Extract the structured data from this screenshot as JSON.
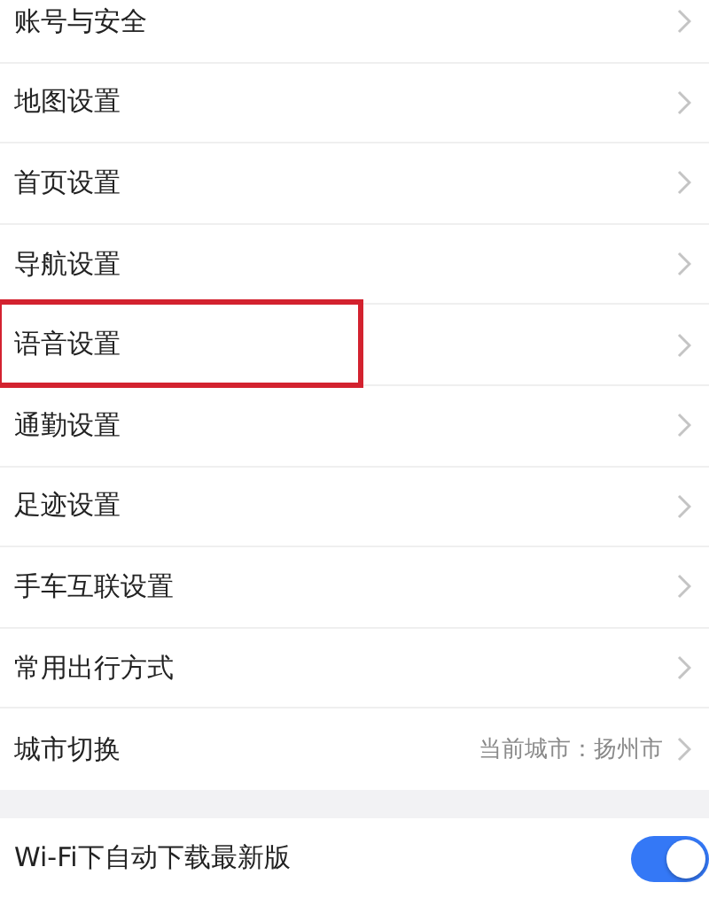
{
  "settings_groups": [
    {
      "items": [
        {
          "kind": "link",
          "label": "账号与安全",
          "highlighted": false
        },
        {
          "kind": "link",
          "label": "地图设置",
          "highlighted": false
        },
        {
          "kind": "link",
          "label": "首页设置",
          "highlighted": false
        },
        {
          "kind": "link",
          "label": "导航设置",
          "highlighted": false
        },
        {
          "kind": "link",
          "label": "语音设置",
          "highlighted": true
        },
        {
          "kind": "link",
          "label": "通勤设置",
          "highlighted": false
        },
        {
          "kind": "link",
          "label": "足迹设置",
          "highlighted": false
        },
        {
          "kind": "link",
          "label": "手车互联设置",
          "highlighted": false
        },
        {
          "kind": "link",
          "label": "常用出行方式",
          "highlighted": false
        },
        {
          "kind": "value",
          "label": "城市切换",
          "value": "当前城市：扬州市",
          "highlighted": false
        }
      ]
    },
    {
      "items": [
        {
          "kind": "toggle",
          "label": "Wi-Fi下自动下载最新版",
          "on": true,
          "highlighted": false
        }
      ]
    }
  ]
}
